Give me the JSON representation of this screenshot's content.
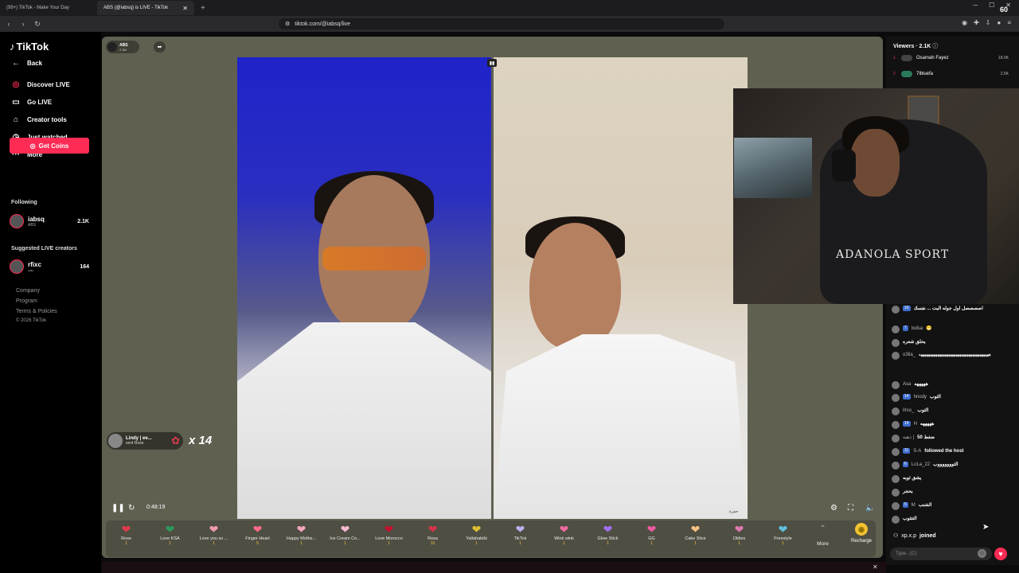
{
  "browser": {
    "tabs": [
      {
        "title": "(99+) TikTok - Make Your Day"
      },
      {
        "title": "ABS (@iabsq) is LIVE - TikTok"
      }
    ],
    "url": "tiktok.com/@iabsq/live",
    "fps_overlay": "60"
  },
  "sidebar": {
    "logo": "TikTok",
    "nav": [
      {
        "label": "Back",
        "icon": "back-arrow-icon"
      },
      {
        "label": "Discover LIVE",
        "icon": "live-icon"
      },
      {
        "label": "Go LIVE",
        "icon": "camera-icon"
      },
      {
        "label": "Creator tools",
        "icon": "home-icon"
      },
      {
        "label": "Just watched",
        "icon": "history-icon"
      },
      {
        "label": "More",
        "icon": "more-icon"
      }
    ],
    "coins_button": "Get Coins",
    "following_title": "Following",
    "following": [
      {
        "name": "iabsq",
        "sub": "ABS",
        "count": "2.1K"
      }
    ],
    "suggested_title": "Suggested LIVE creators",
    "suggested": [
      {
        "name": "rfixc",
        "sub": "نجد",
        "count": "164"
      }
    ],
    "footer": [
      "Company",
      "Program",
      "Terms & Policies",
      "© 2026 TikTok"
    ]
  },
  "stream": {
    "host_name": "ABS",
    "host_likes": "2.3M",
    "gift_note": {
      "user": "Lindy | ee...",
      "action": "sent Rose",
      "combo": "x 14"
    },
    "elapsed": "0:48:19",
    "watermark": "حمزة"
  },
  "gifts": [
    {
      "name": "Rose",
      "price": "1",
      "icon": "rose-icon",
      "color": "#e23b4e"
    },
    {
      "name": "Love KSA",
      "price": "1",
      "icon": "ksa-heart-icon",
      "color": "#2c9a5a"
    },
    {
      "name": "Love you so ...",
      "price": "1",
      "icon": "heart-face-icon",
      "color": "#f39ab0"
    },
    {
      "name": "Finger Heart",
      "price": "5",
      "icon": "finger-heart-icon",
      "color": "#ff6b88"
    },
    {
      "name": "Happy Mothe...",
      "price": "1",
      "icon": "flower-heart-icon",
      "color": "#f4a8c0"
    },
    {
      "name": "Ice Cream Co...",
      "price": "1",
      "icon": "ice-cream-icon",
      "color": "#f7b9d0"
    },
    {
      "name": "Love Morocco",
      "price": "1",
      "icon": "morocco-heart-icon",
      "color": "#c8102e"
    },
    {
      "name": "Rosa",
      "price": "10",
      "icon": "rosa-icon",
      "color": "#d6334a"
    },
    {
      "name": "Yallahabibi",
      "price": "1",
      "icon": "yallahabibi-icon",
      "color": "#e0c030"
    },
    {
      "name": "TikTok",
      "price": "1",
      "icon": "tiktok-gift-icon",
      "color": "#c0b0f0"
    },
    {
      "name": "Wink wink",
      "price": "1",
      "icon": "wink-icon",
      "color": "#f06aa0"
    },
    {
      "name": "Glow Stick",
      "price": "1",
      "icon": "glow-stick-icon",
      "color": "#a070f0"
    },
    {
      "name": "GG",
      "price": "1",
      "icon": "gg-icon",
      "color": "#f05aa0"
    },
    {
      "name": "Cake Slice",
      "price": "1",
      "icon": "cake-icon",
      "color": "#f5c080"
    },
    {
      "name": "Oldies",
      "price": "1",
      "icon": "oldies-icon",
      "color": "#e07ab0"
    },
    {
      "name": "Freestyle",
      "price": "1",
      "icon": "freestyle-icon",
      "color": "#60c0e0"
    }
  ],
  "gift_more": "More",
  "recharge": "Recharge",
  "viewers": {
    "title": "Viewers · 2.1K",
    "list": [
      {
        "rank": "1",
        "name": "Osamah Fayez",
        "count": "18.0K"
      },
      {
        "rank": "2",
        "name": "7lbluefa",
        "count": "2.5K"
      }
    ]
  },
  "webcam": {
    "hoodie_text": "ADANOLA SPORT"
  },
  "chat": [
    {
      "level": "10",
      "user": "",
      "text": "اصصصصل اول جوله البت ... نفسك"
    },
    {
      "level": "7",
      "user": "lodsa",
      "text": "😁"
    },
    {
      "level": "",
      "user": "",
      "text": "يحلق شعره"
    },
    {
      "level": "",
      "user": "o3lia_",
      "text": "ههههههههههههههههههههههههههههههههههههههه"
    },
    {
      "level": "",
      "user": "Asa",
      "text": "هههههه"
    },
    {
      "level": "14",
      "user": "hnody",
      "text": "الثوب"
    },
    {
      "level": "",
      "user": "ilrso_",
      "text": "الثوب"
    },
    {
      "level": "14",
      "user": "H",
      "text": "هههههه"
    },
    {
      "level": "",
      "user": "ذهبه |",
      "text": "ضغط 50"
    },
    {
      "level": "11",
      "user": "S-A",
      "text": "followed the host"
    },
    {
      "level": "6",
      "user": "LoLa_22",
      "text": "الثوووووووب"
    },
    {
      "level": "",
      "user": "",
      "text": "يشق ثوبه"
    },
    {
      "level": "",
      "user": "",
      "text": "بحجر"
    },
    {
      "level": "5",
      "user": "M",
      "text": "الشنب"
    },
    {
      "level": "",
      "user": "",
      "text": "التتثوب"
    }
  ],
  "joined": {
    "user": "xp.x.p",
    "text": "joined"
  },
  "chat_input_placeholder": "Type...(C)"
}
